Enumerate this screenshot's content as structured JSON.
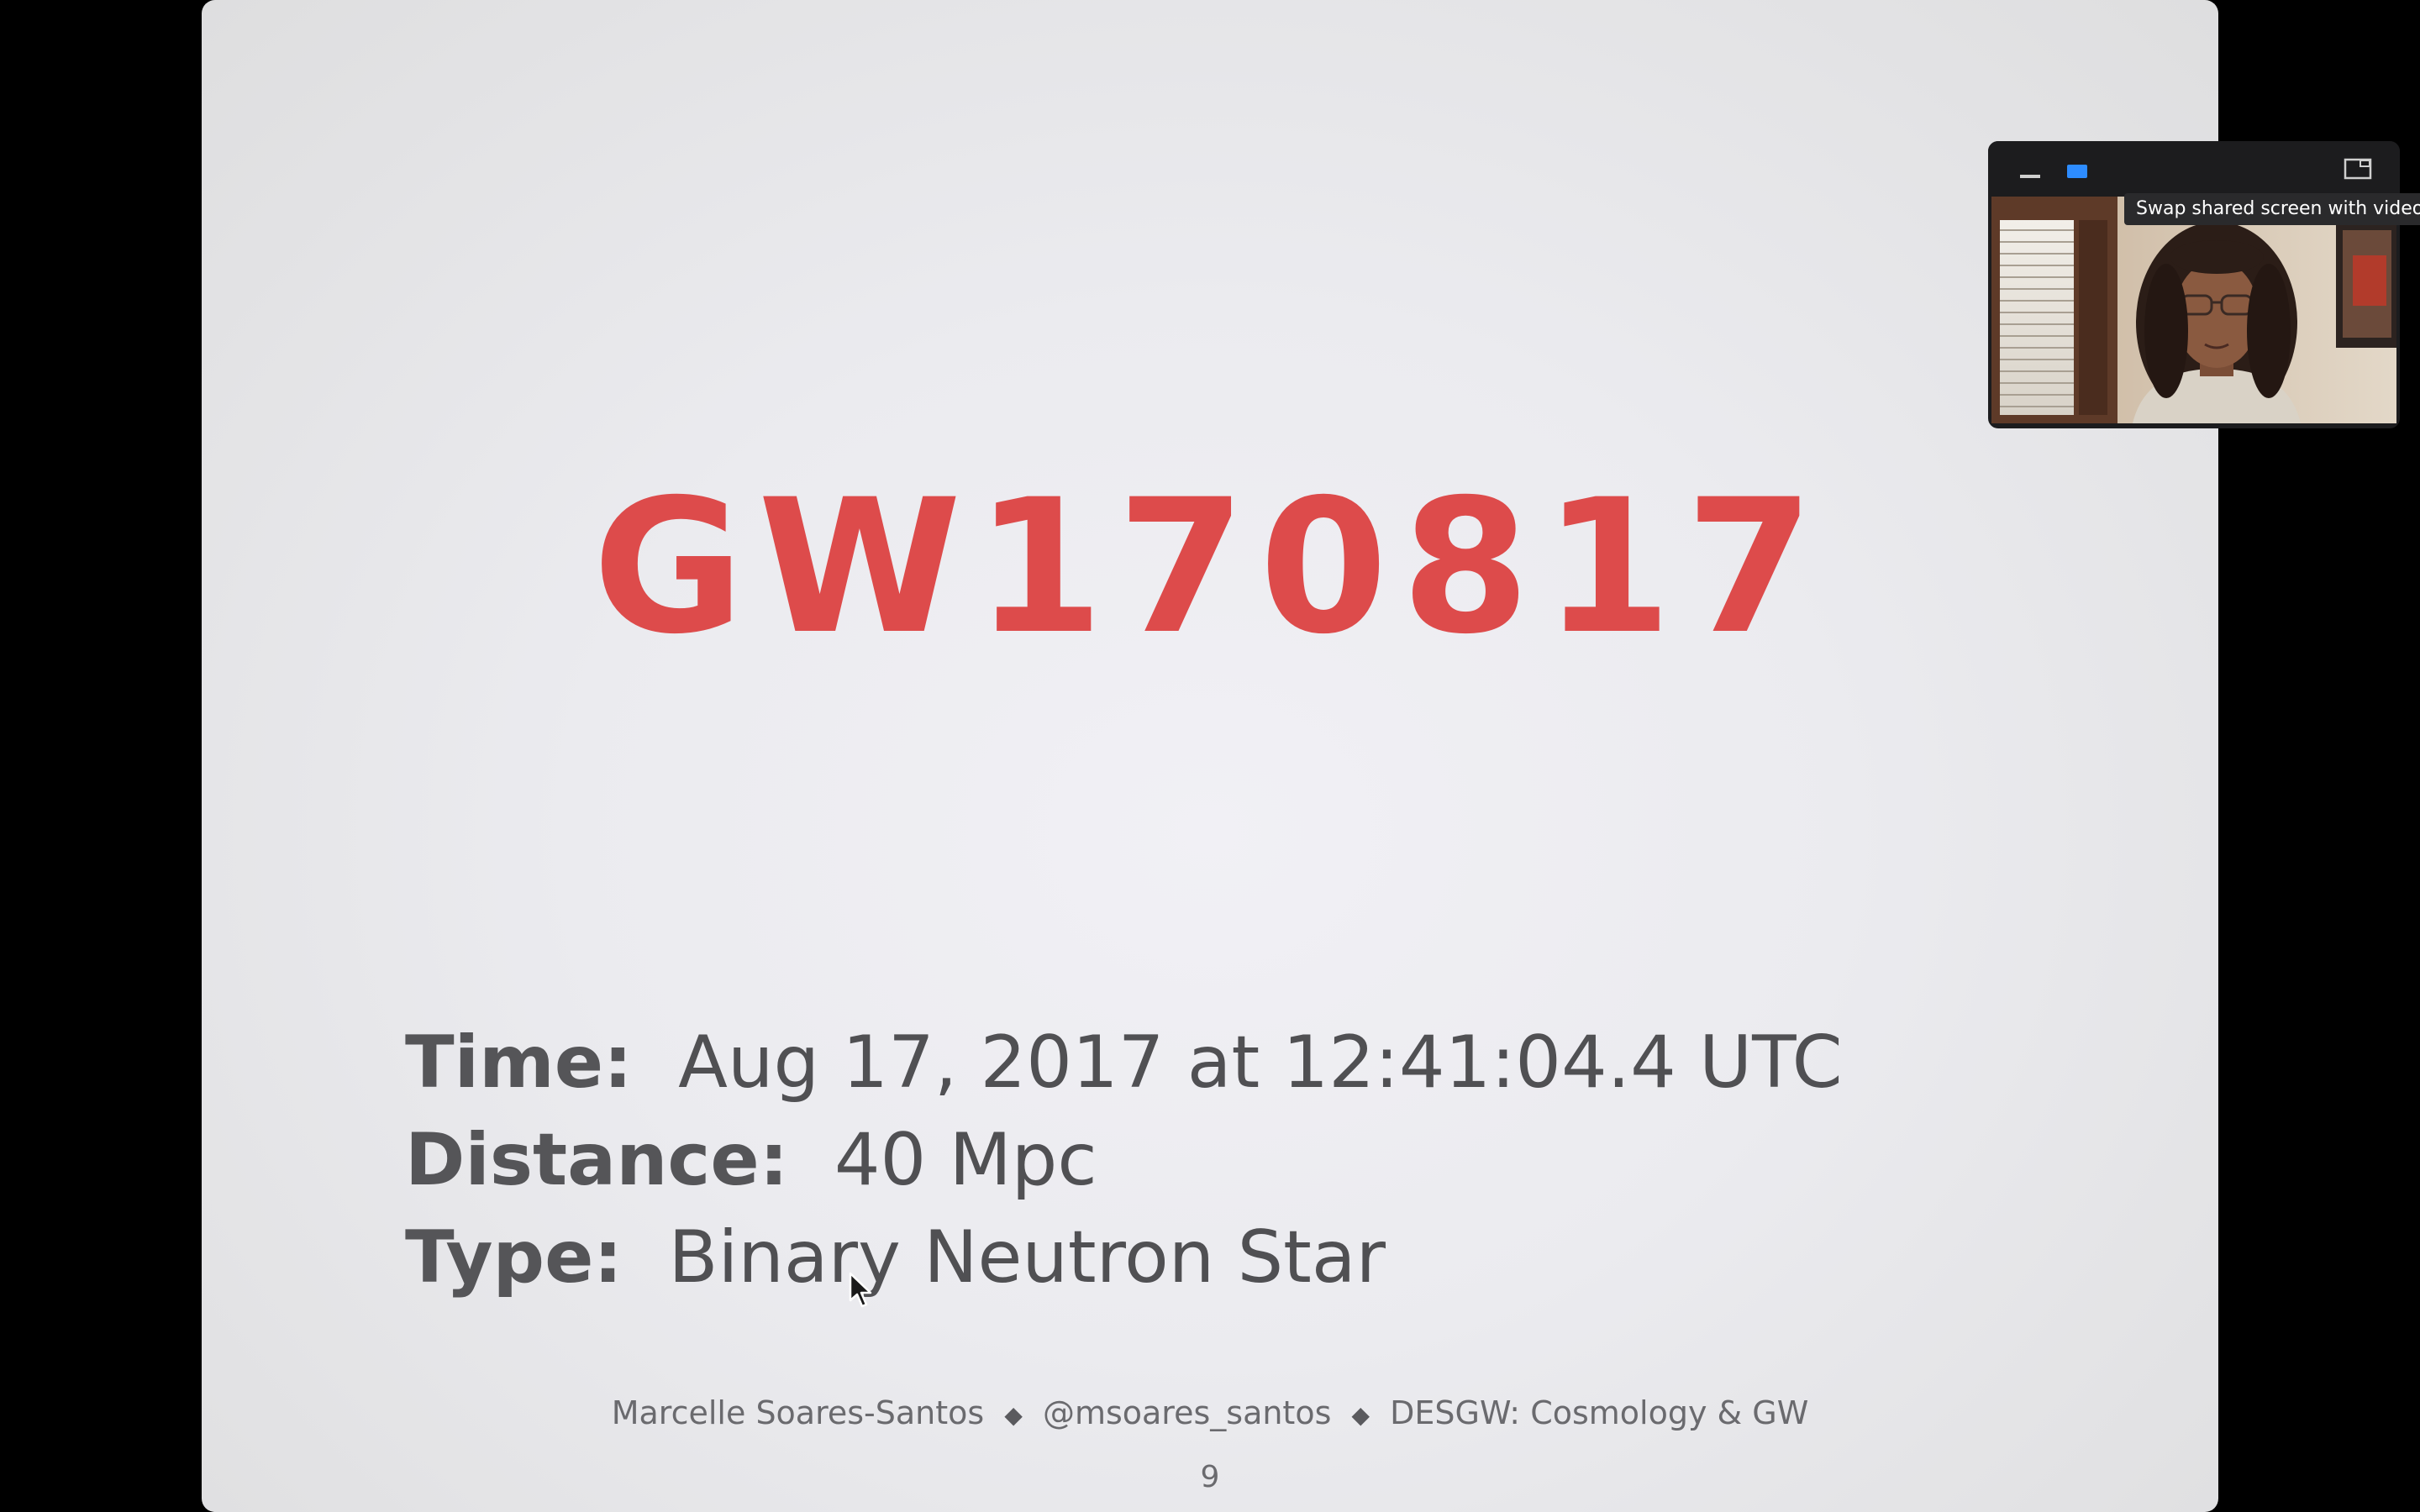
{
  "slide": {
    "title": "GW170817",
    "time_label": "Time:",
    "time_value": "Aug 17, 2017 at 12:41:04.4 UTC",
    "distance_label": "Distance:",
    "distance_value": "40 Mpc",
    "type_label": "Type:",
    "type_value": "Binary Neutron Star",
    "footer": {
      "author": "Marcelle Soares-Santos",
      "handle": "@msoares_santos",
      "talk": "DESGW: Cosmology & GW",
      "separator": "◆"
    },
    "page_number": "9",
    "title_color": "#dd4b4b"
  },
  "video_panel": {
    "tooltip": "Swap shared screen with video",
    "minimize_icon": "minimize-icon",
    "active_view_icon": "active-speaker-view-icon",
    "swap_icon": "swap-screen-icon",
    "accent_color": "#2d8cff"
  }
}
